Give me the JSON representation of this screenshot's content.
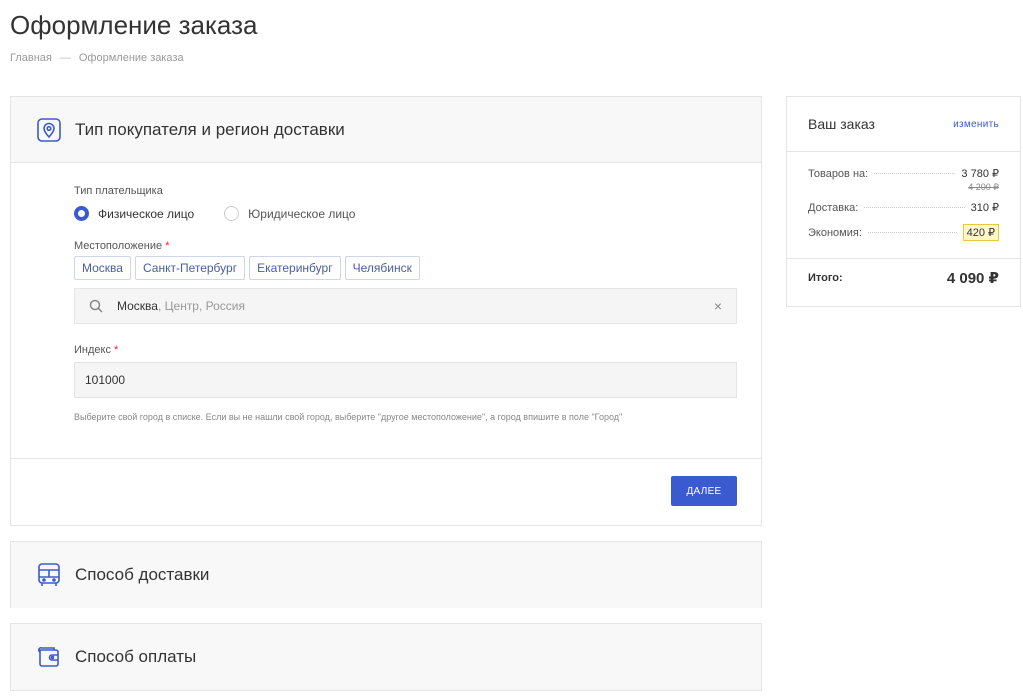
{
  "page": {
    "title": "Оформление заказа",
    "breadcrumb": {
      "home": "Главная",
      "separator": "—",
      "current": "Оформление заказа"
    }
  },
  "section_buyer": {
    "title": "Тип покупателя и регион доставки",
    "payer_label": "Тип плательщика",
    "payer_options": [
      "Физическое лицо",
      "Юридическое лицо"
    ],
    "payer_selected": "Физическое лицо",
    "location_label": "Местоположение",
    "required_mark": "*",
    "cities": [
      "Москва",
      "Санкт-Петербург",
      "Екатеринбург",
      "Челябинск"
    ],
    "location_value_city": "Москва",
    "location_value_rest": ", Центр, Россия",
    "clear_symbol": "×",
    "index_label": "Индекс",
    "index_value": "101000",
    "hint": "Выберите свой город в списке. Если вы не нашли свой город, выберите \"другое местоположение\", а город впишите в поле \"Город\"",
    "next_button": "ДАЛЕЕ"
  },
  "section_delivery": {
    "title": "Способ доставки"
  },
  "section_payment": {
    "title": "Способ оплаты"
  },
  "order": {
    "title": "Ваш заказ",
    "edit_link": "изменить",
    "goods_label": "Товаров на:",
    "goods_value": "3 780 ₽",
    "goods_old_value": "4 200 ₽",
    "delivery_label": "Доставка:",
    "delivery_value": "310 ₽",
    "economy_label": "Экономия:",
    "economy_value": "420 ₽",
    "total_label": "Итого:",
    "total_value": "4 090 ₽"
  },
  "colors": {
    "accent": "#3a5bcf",
    "required": "#e22233",
    "economy_badge": "#fff7c8"
  },
  "icons": {
    "buyer_section": "location-pin-icon",
    "delivery_section": "bus-icon",
    "payment_section": "wallet-icon",
    "search": "search-icon",
    "clear": "close-icon"
  }
}
